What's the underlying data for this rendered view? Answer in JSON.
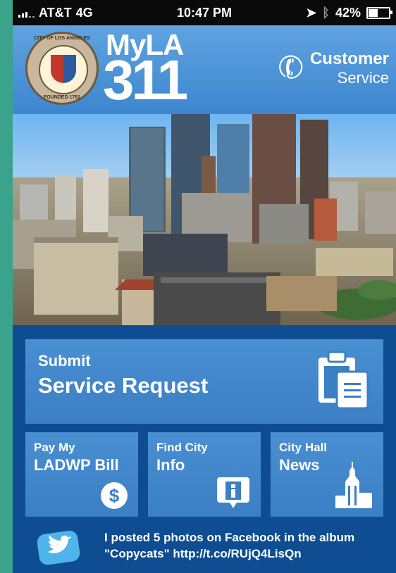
{
  "status_bar": {
    "carrier": "AT&T",
    "network": "4G",
    "time": "10:47 PM",
    "battery": "42%",
    "icons": [
      "signal-icon",
      "location-arrow-icon",
      "bluetooth-icon",
      "battery-icon"
    ]
  },
  "header": {
    "seal_text_top": "CITY OF LOS ANGELES",
    "seal_text_bottom": "FOUNDED 1781",
    "logo_line1": "MyLA",
    "logo_line2": "311",
    "customer_service_line1": "Customer",
    "customer_service_line2": "Service",
    "customer_service_icon": "phone-icon"
  },
  "tiles": {
    "submit": {
      "line1": "Submit",
      "line2": "Service Request",
      "icon": "clipboard-icon"
    },
    "pay": {
      "line1": "Pay My",
      "line2": "LADWP Bill",
      "icon": "dollar-coin-icon"
    },
    "find": {
      "line1": "Find City",
      "line2": "Info",
      "icon": "info-bubble-icon"
    },
    "news": {
      "line1": "City Hall",
      "line2": "News",
      "icon": "city-hall-icon"
    }
  },
  "tweet": {
    "icon": "twitter-bird-icon",
    "text": "I posted 5 photos on Facebook in the album \"Copycats\" http://t.co/RUjQ4LisQn"
  },
  "colors": {
    "background_green": "#3aa38b",
    "header_blue": "#4a93d8",
    "tile_blue": "#4289cc",
    "dark_blue": "#0f4d93"
  }
}
